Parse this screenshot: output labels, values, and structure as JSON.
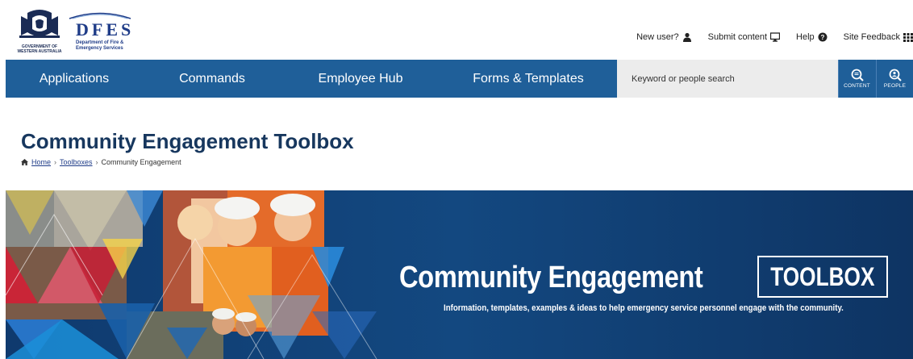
{
  "header": {
    "wa_logo_text": "GOVERNMENT OF WESTERN AUSTRALIA",
    "dfes_title": "DFES",
    "dfes_subtitle_line1": "Department of Fire &",
    "dfes_subtitle_line2": "Emergency Services"
  },
  "utility_links": [
    {
      "label": "New user?",
      "icon": "user-icon"
    },
    {
      "label": "Submit content",
      "icon": "monitor-icon"
    },
    {
      "label": "Help",
      "icon": "help-icon"
    },
    {
      "label": "Site Feedback",
      "icon": "grid-icon"
    }
  ],
  "nav": {
    "items": [
      "Applications",
      "Commands",
      "Employee Hub",
      "Forms & Templates"
    ],
    "search_placeholder": "Keyword or people search",
    "content_btn": "CONTENT",
    "people_btn": "PEOPLE"
  },
  "page": {
    "title": "Community Engagement Toolbox",
    "breadcrumb": [
      "Home",
      "Toolboxes",
      "Community Engagement"
    ]
  },
  "banner": {
    "title": "Community Engagement",
    "badge": "TOOLBOX",
    "subtitle": "Information, templates, examples & ideas to help emergency service personnel engage with the community."
  },
  "colors": {
    "nav_bg": "#1f5f99",
    "banner_bg": "#124077",
    "title_color": "#17375e"
  }
}
